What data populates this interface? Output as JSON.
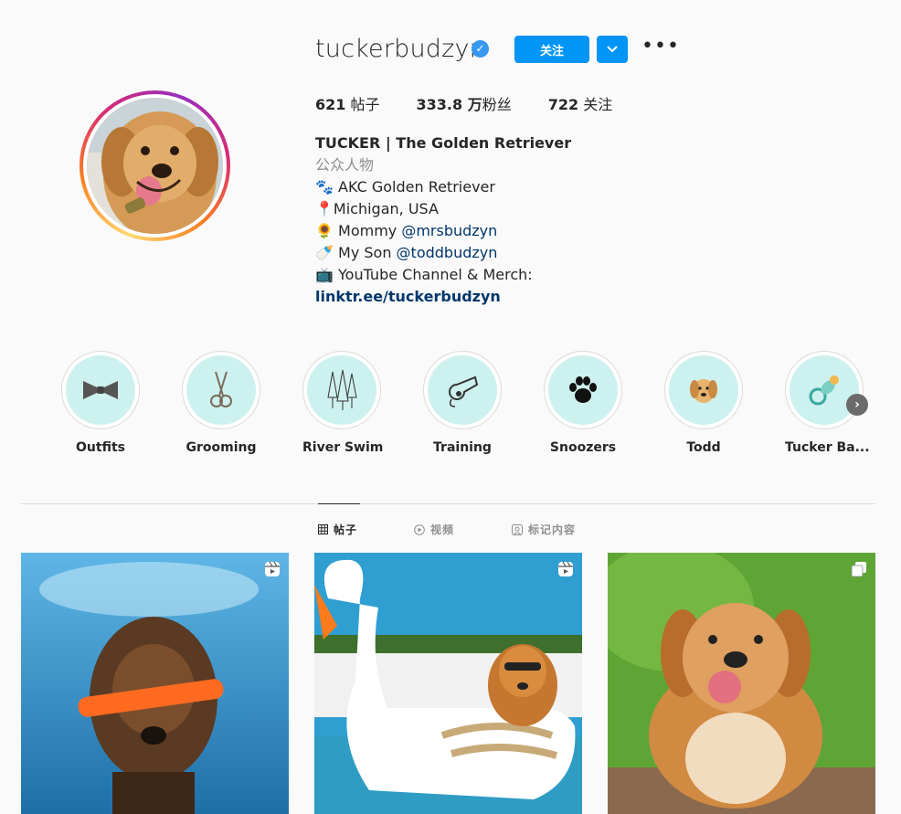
{
  "profile": {
    "username": "tuckerbudzyn",
    "verified": true,
    "follow_label": "关注",
    "stats": {
      "posts_value": "621",
      "posts_label": "帖子",
      "followers_value": "333.8 万",
      "followers_label": "粉丝",
      "following_value": "722",
      "following_label": "关注"
    }
  },
  "bio": {
    "name": "TUCKER | The Golden Retriever",
    "category": "公众人物",
    "line1": "🐾 AKC Golden Retriever",
    "line2": "📍Michigan, USA",
    "line3_prefix": "🌻 Mommy ",
    "line3_mention": "@mrsbudzyn",
    "line4_prefix": "🍼 My Son ",
    "line4_mention": "@toddbudzyn",
    "line5": "📺 YouTube Channel & Merch:",
    "link": "linktr.ee/tuckerbudzyn"
  },
  "highlights": [
    {
      "label": "Outfits",
      "icon": "bow-tie-icon"
    },
    {
      "label": "Grooming",
      "icon": "scissors-icon"
    },
    {
      "label": "River Swim",
      "icon": "pine-trees-icon"
    },
    {
      "label": "Training",
      "icon": "whistle-icon"
    },
    {
      "label": "Snoozers",
      "icon": "paw-icon"
    },
    {
      "label": "Todd",
      "icon": "puppy-icon"
    },
    {
      "label": "Tucker Ba...",
      "icon": "pacifier-icon"
    }
  ],
  "tabs": [
    {
      "label": "帖子",
      "icon": "grid-icon",
      "active": true
    },
    {
      "label": "视频",
      "icon": "play-icon",
      "active": false
    },
    {
      "label": "标记内容",
      "icon": "tag-icon",
      "active": false
    }
  ],
  "posts": [
    {
      "type": "reel",
      "badge_icon": "reels-icon"
    },
    {
      "type": "reel",
      "badge_icon": "reels-icon"
    },
    {
      "type": "carousel",
      "badge_icon": "carousel-icon"
    }
  ],
  "colors": {
    "accent": "#0095f6",
    "highlight_bg": "#cdf1ee",
    "mention": "#00376b"
  }
}
